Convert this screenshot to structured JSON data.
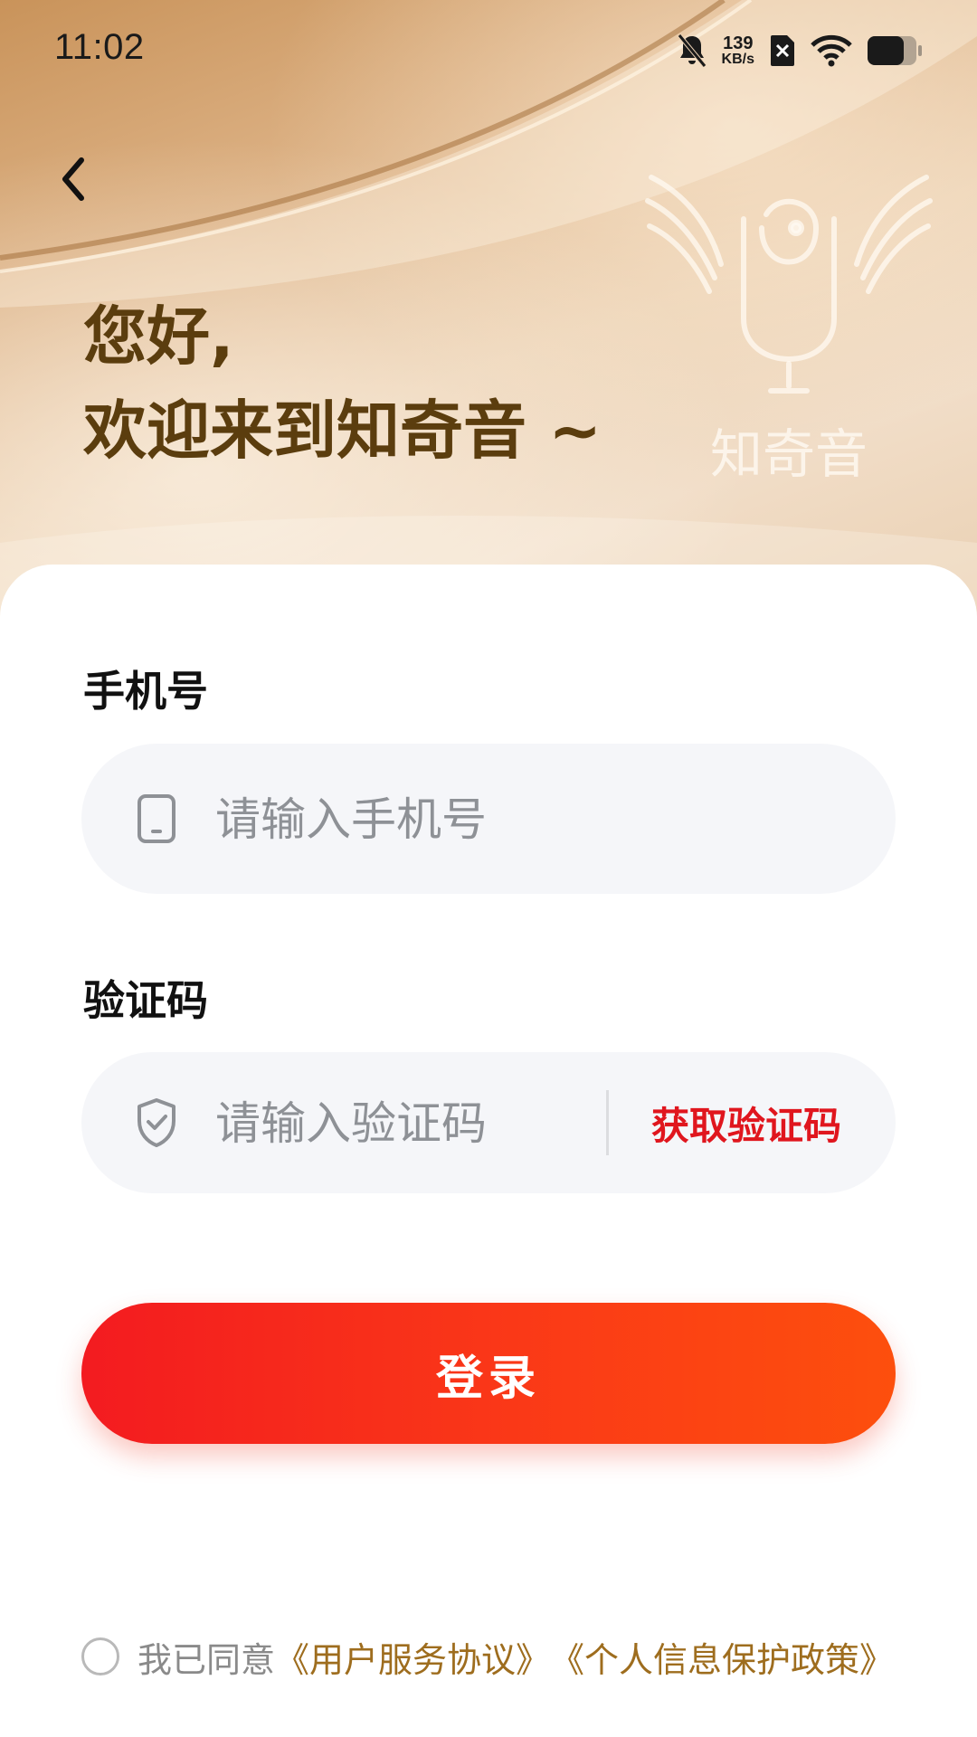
{
  "status_bar": {
    "time": "11:02",
    "net_speed_value": "139",
    "net_speed_unit": "KB/s",
    "icons": [
      "bell-muted-icon",
      "sim-off-icon",
      "wifi-icon",
      "battery-icon"
    ]
  },
  "header": {
    "greeting_line1": "您好,",
    "greeting_line2": "欢迎来到知奇音 ~",
    "logo_text": "知奇音"
  },
  "form": {
    "phone_label": "手机号",
    "phone_placeholder": "请输入手机号",
    "code_label": "验证码",
    "code_placeholder": "请输入验证码",
    "get_code": "获取验证码",
    "login": "登录"
  },
  "agreement": {
    "prefix": "我已同意",
    "user_agreement": "《用户服务协议》",
    "privacy_policy": "《个人信息保护政策》"
  },
  "colors": {
    "accent_red": "#e0161e",
    "greeting": "#5b3d0e",
    "link_gold": "#9e6d1e"
  }
}
